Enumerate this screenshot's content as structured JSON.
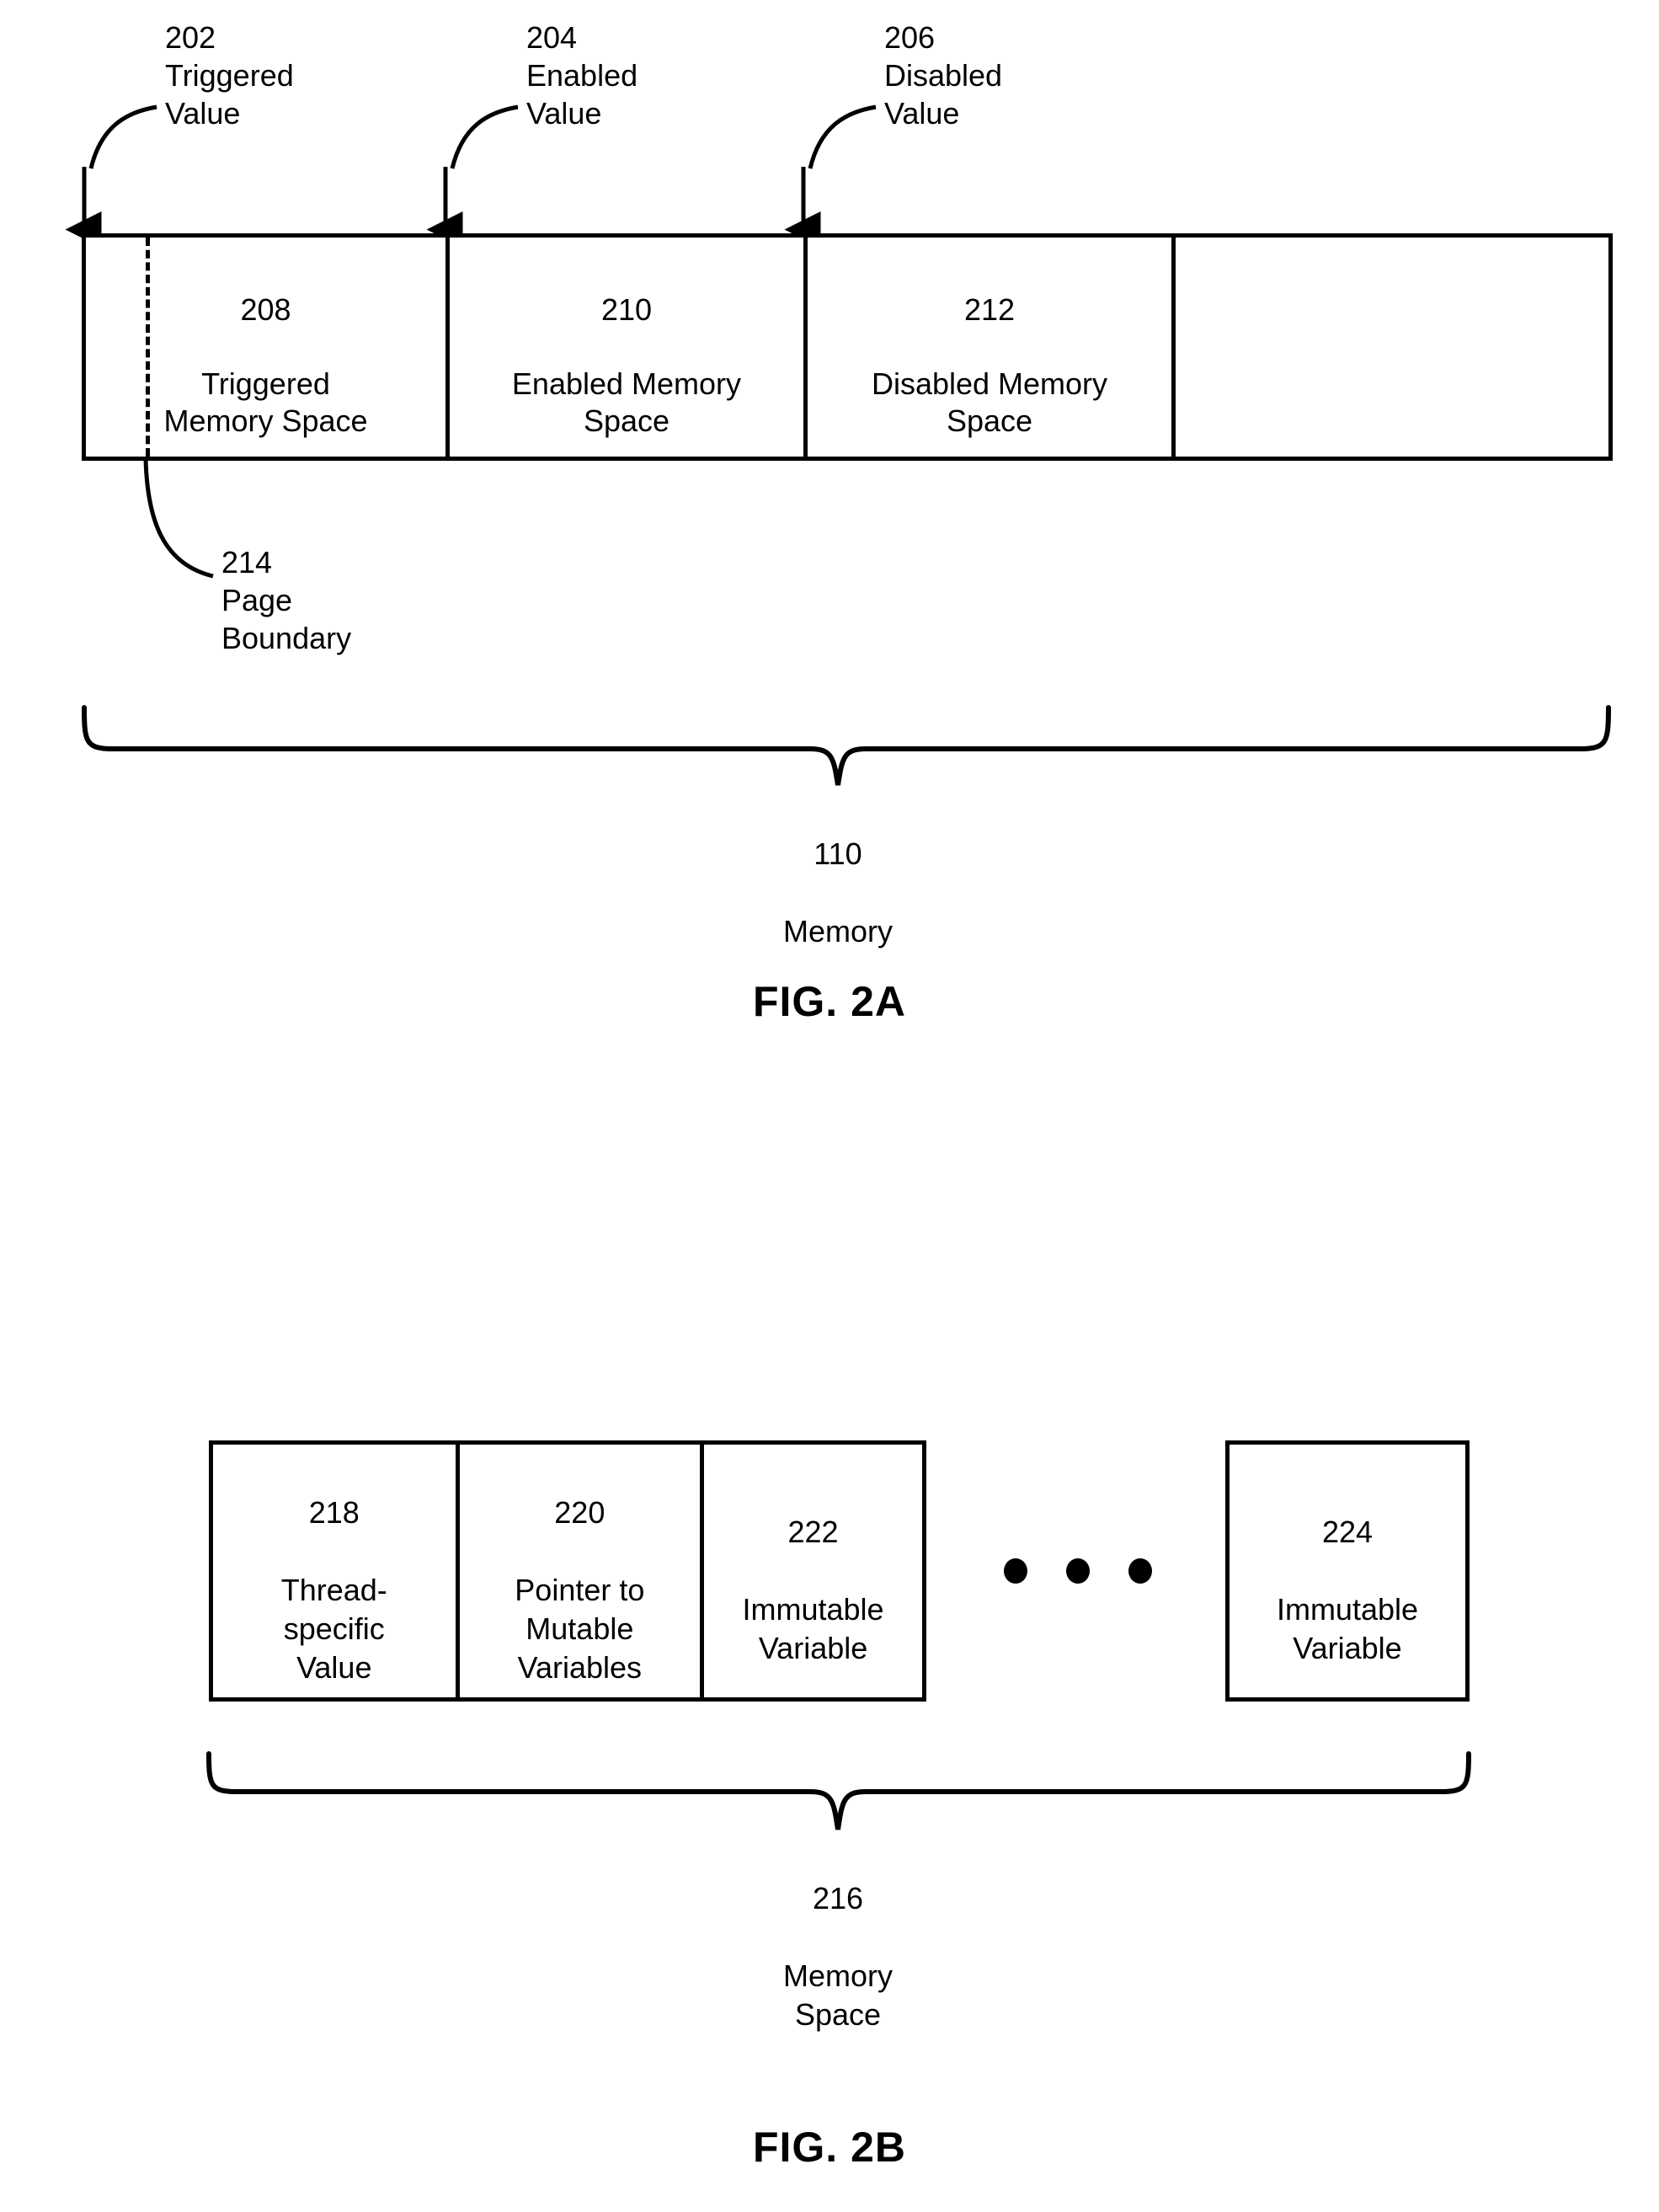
{
  "sheet": {
    "background": "#ffffff",
    "ink": "#000000"
  },
  "fig2a": {
    "title": "FIG. 2A",
    "callouts": [
      {
        "ref": "202",
        "text": "Triggered\nValue"
      },
      {
        "ref": "204",
        "text": "Enabled\nValue"
      },
      {
        "ref": "206",
        "text": "Disabled\nValue"
      }
    ],
    "cells": [
      {
        "ref": "208",
        "label": "Triggered\nMemory Space"
      },
      {
        "ref": "210",
        "label": "Enabled Memory\nSpace"
      },
      {
        "ref": "212",
        "label": "Disabled Memory\nSpace"
      },
      {
        "ref": "",
        "label": ""
      }
    ],
    "page_boundary": {
      "ref": "214",
      "text": "Page\nBoundary"
    },
    "brace": {
      "ref": "110",
      "text": "Memory"
    }
  },
  "fig2b": {
    "title": "FIG. 2B",
    "cells": [
      {
        "ref": "218",
        "label": "Thread-\nspecific\nValue"
      },
      {
        "ref": "220",
        "label": "Pointer to\nMutable\nVariables"
      },
      {
        "ref": "222",
        "label": "Immutable\nVariable"
      }
    ],
    "ellipsis_dots": 3,
    "last_cell": {
      "ref": "224",
      "label": "Immutable\nVariable"
    },
    "brace": {
      "ref": "216",
      "text": "Memory\nSpace"
    }
  }
}
